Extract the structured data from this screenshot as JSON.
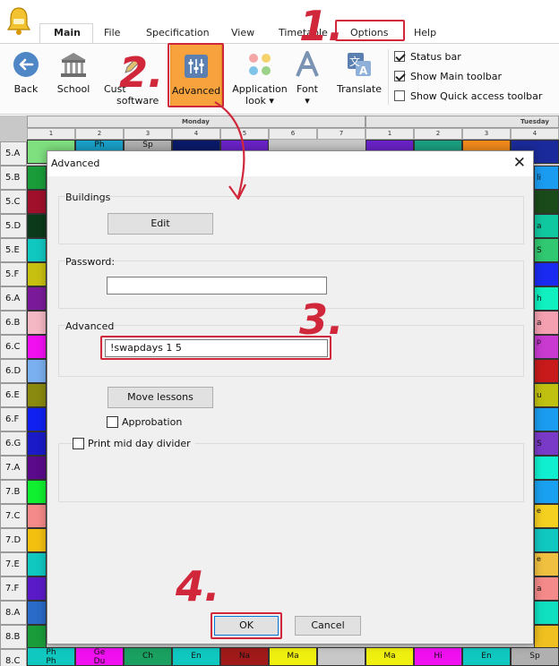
{
  "ribbon": {
    "tabs": [
      "Main",
      "File",
      "Specification",
      "View",
      "Timetable",
      "Options",
      "Help"
    ],
    "buttons": {
      "back": "Back",
      "school": "School",
      "customize_1": "Cust",
      "customize_2": "software",
      "advanced": "Advanced",
      "app_look_1": "Application",
      "app_look_2": "look",
      "font": "Font",
      "translate": "Translate"
    },
    "options": {
      "status_bar": "Status bar",
      "main_toolbar": "Show Main toolbar",
      "quick_access": "Show Quick access toolbar"
    }
  },
  "timetable": {
    "days": [
      "Monday",
      "Tuesday"
    ],
    "periods": [
      "1",
      "2",
      "3",
      "4",
      "5",
      "6",
      "7"
    ],
    "tuesday_periods": [
      "1",
      "2",
      "3",
      "4"
    ],
    "classes": [
      "5.A",
      "5.B",
      "5.C",
      "5.D",
      "5.E",
      "5.F",
      "6.A",
      "6.B",
      "6.C",
      "6.D",
      "6.E",
      "6.F",
      "6.G",
      "7.A",
      "7.B",
      "7.C",
      "7.D",
      "7.E",
      "7.F",
      "8.A",
      "8.B",
      "8.C"
    ],
    "top_row_subjects": [
      "Ph",
      "Sp"
    ],
    "bottom_row_subjects": [
      "Ph",
      "Ge",
      "Ch",
      "En",
      "Na",
      "Ma",
      "Ma",
      "Hi",
      "En",
      "Sp"
    ],
    "bottom_row_sub": [
      "Ph",
      "Du"
    ],
    "peek_chars": [
      "li",
      "a",
      "S",
      "h",
      "a",
      "p",
      "h",
      "u",
      "S",
      "e",
      "e",
      "a"
    ]
  },
  "dialog": {
    "title": "Advanced",
    "close_glyph": "✕",
    "buildings_label": "Buildings",
    "edit_button": "Edit",
    "password_label": "Password:",
    "password_value": "",
    "advanced_label": "Advanced",
    "advanced_value": "!swapdays 1 5",
    "move_lessons_button": "Move lessons",
    "approbation_label": "Approbation",
    "print_divider_label": "Print mid day divider",
    "ok_button": "OK",
    "cancel_button": "Cancel"
  },
  "annotations": {
    "step1": "1.",
    "step2": "2.",
    "step3": "3.",
    "step4": "4."
  },
  "colors": {
    "annotation_red": "#d1273b",
    "advanced_button_orange": "#f7a23c"
  }
}
